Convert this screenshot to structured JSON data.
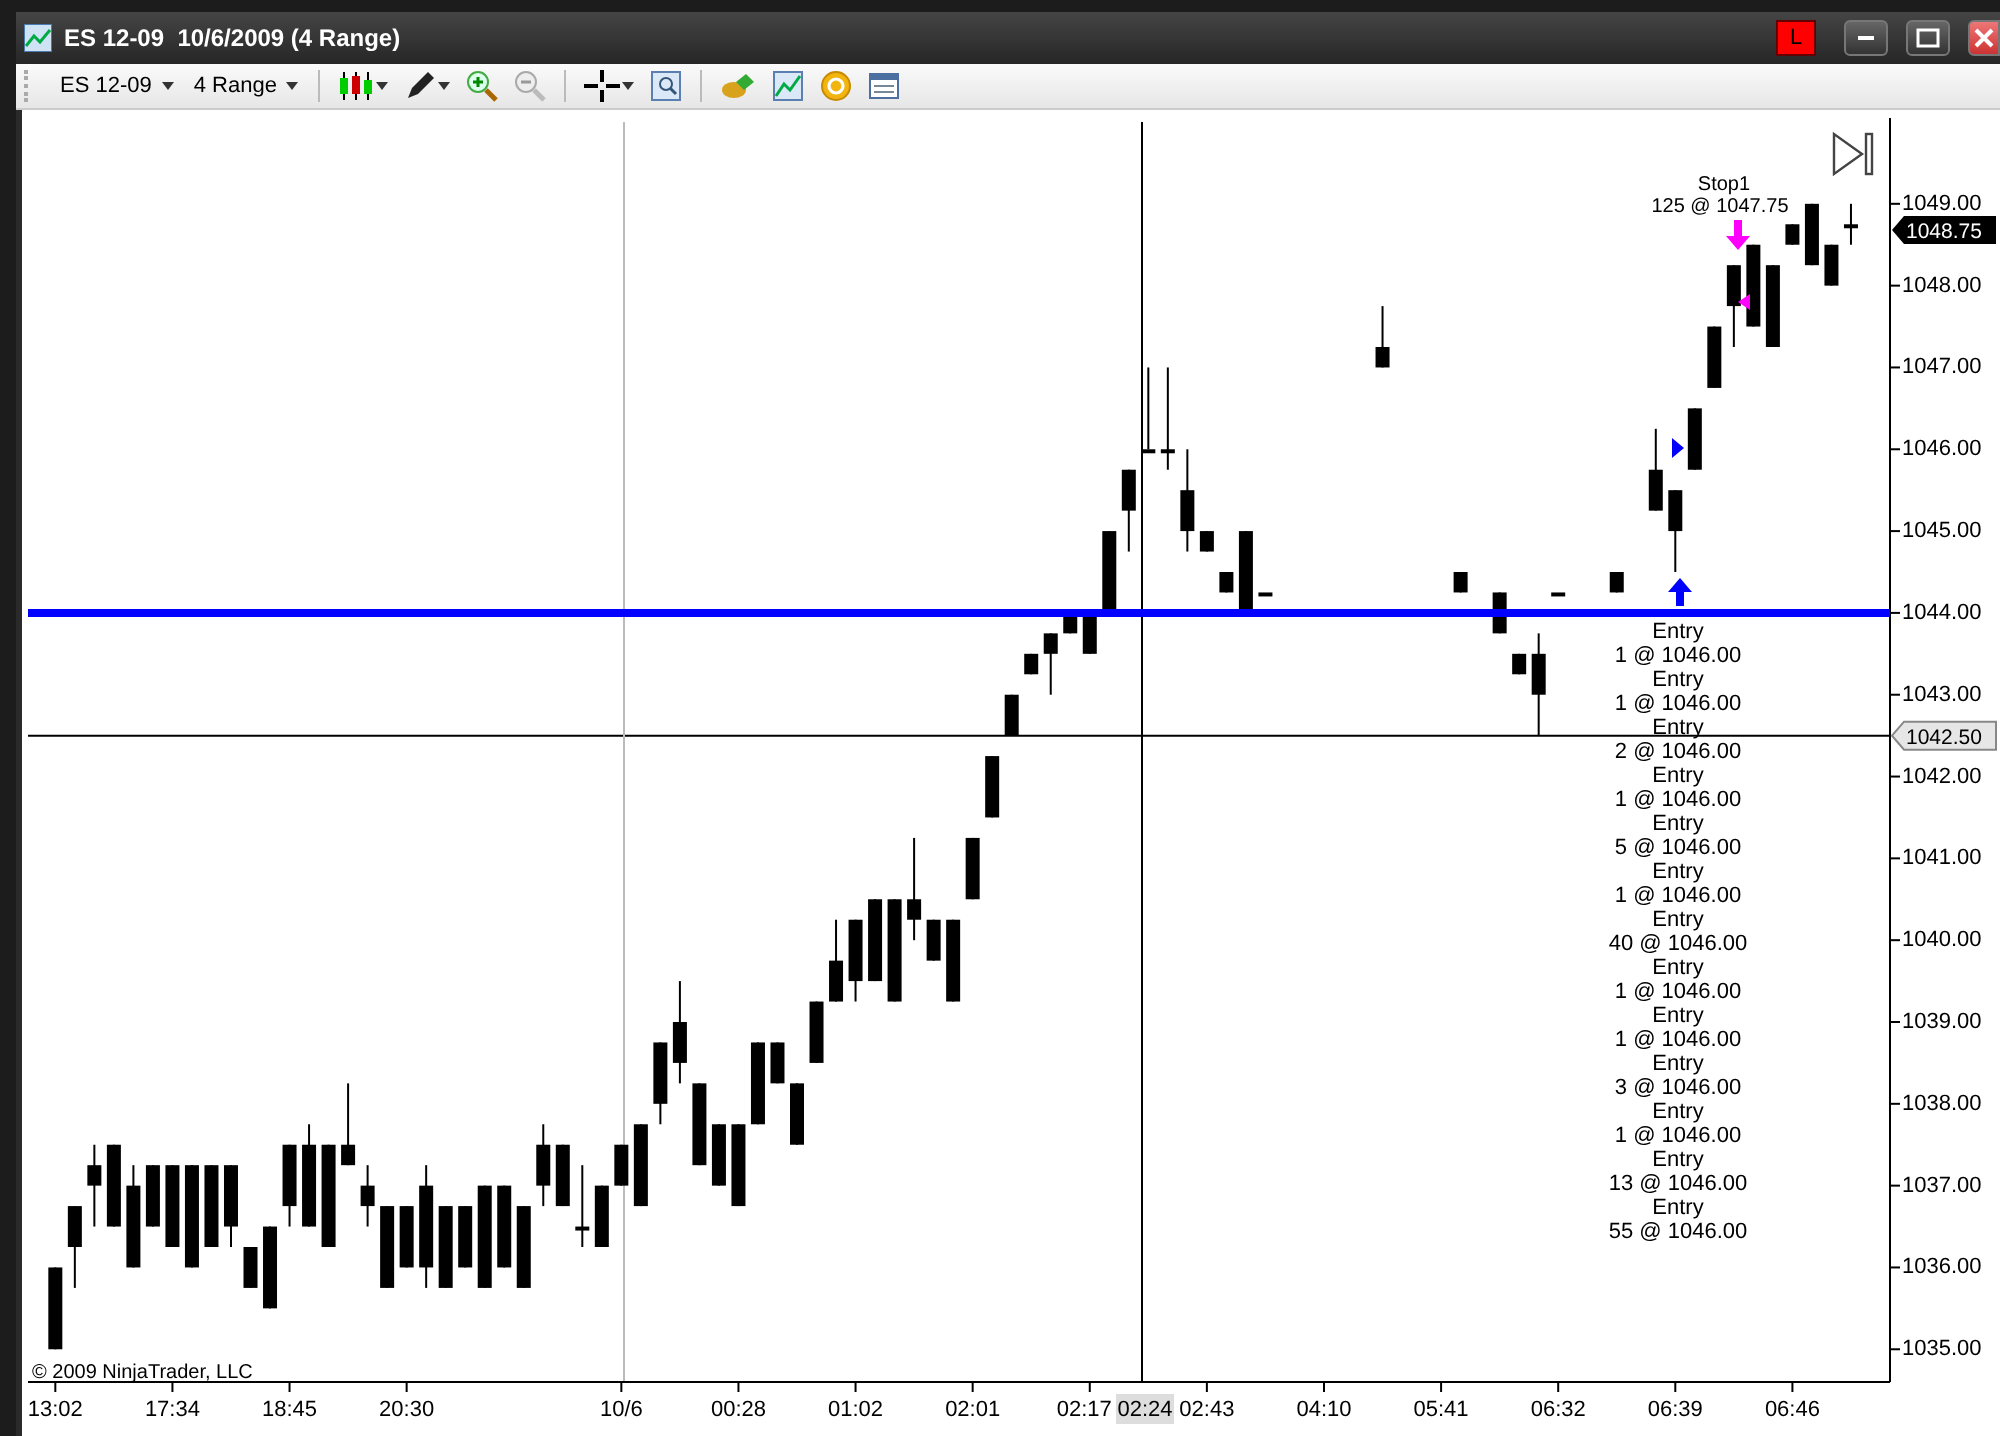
{
  "window": {
    "title": "ES 12-09  10/6/2009 (4 Range)",
    "account_badge": "L"
  },
  "toolbar": {
    "instrument": "ES 12-09",
    "period": "4 Range"
  },
  "chart": {
    "chart_data": {
      "type": "candlestick",
      "ylim": [
        1034.6,
        1050
      ],
      "categories": [
        "13:02",
        null,
        null,
        null,
        null,
        null,
        "17:34",
        null,
        null,
        null,
        null,
        null,
        "18:45",
        null,
        null,
        null,
        null,
        null,
        "20:30",
        null,
        null,
        null,
        null,
        null,
        null,
        null,
        null,
        null,
        null,
        "10/6",
        null,
        null,
        null,
        null,
        null,
        "00:28",
        null,
        null,
        null,
        null,
        null,
        "01:02",
        null,
        null,
        null,
        null,
        null,
        "02:01",
        null,
        null,
        null,
        null,
        null,
        "02:17",
        null,
        null,
        null,
        null,
        null,
        "02:43",
        null,
        null,
        null,
        null,
        null,
        "04:10",
        null,
        null,
        null,
        null,
        null,
        "05:41",
        null,
        null,
        null,
        null,
        null,
        "06:32",
        null,
        null,
        null,
        null,
        null,
        "06:39",
        null,
        null,
        null,
        null,
        null,
        "06:46",
        null,
        null,
        null
      ],
      "ohlc": [
        [
          1036.0,
          1036.0,
          1035.0,
          1035.0
        ],
        [
          1036.75,
          1036.75,
          1035.75,
          1036.25
        ],
        [
          1037.25,
          1037.5,
          1036.5,
          1037.0
        ],
        [
          1037.5,
          1037.5,
          1036.5,
          1036.5
        ],
        [
          1037.0,
          1037.25,
          1036.0,
          1036.0
        ],
        [
          1037.25,
          1037.25,
          1036.5,
          1036.5
        ],
        [
          1037.25,
          1037.25,
          1036.25,
          1036.25
        ],
        [
          1037.25,
          1037.25,
          1036.0,
          1036.0
        ],
        [
          1037.25,
          1037.25,
          1036.25,
          1036.25
        ],
        [
          1037.25,
          1037.25,
          1036.25,
          1036.5
        ],
        [
          1036.25,
          1036.25,
          1035.75,
          1035.75
        ],
        [
          1036.5,
          1036.5,
          1035.5,
          1035.5
        ],
        [
          1037.5,
          1037.5,
          1036.5,
          1036.75
        ],
        [
          1037.5,
          1037.75,
          1036.5,
          1036.5
        ],
        [
          1037.5,
          1037.5,
          1036.25,
          1036.25
        ],
        [
          1037.5,
          1038.25,
          1037.25,
          1037.25
        ],
        [
          1037.0,
          1037.25,
          1036.5,
          1036.75
        ],
        [
          1036.75,
          1036.75,
          1035.75,
          1035.75
        ],
        [
          1036.75,
          1036.75,
          1036.0,
          1036.0
        ],
        [
          1037.0,
          1037.25,
          1035.75,
          1036.0
        ],
        [
          1036.75,
          1036.75,
          1035.75,
          1035.75
        ],
        [
          1036.75,
          1036.75,
          1036.0,
          1036.0
        ],
        [
          1037.0,
          1037.0,
          1035.75,
          1035.75
        ],
        [
          1037.0,
          1037.0,
          1036.0,
          1036.0
        ],
        [
          1036.75,
          1036.75,
          1035.75,
          1035.75
        ],
        [
          1037.5,
          1037.75,
          1036.75,
          1037.0
        ],
        [
          1037.5,
          1037.5,
          1036.75,
          1036.75
        ],
        [
          1036.5,
          1037.25,
          1036.25,
          1036.5
        ],
        [
          1037.0,
          1037.0,
          1036.25,
          1036.25
        ],
        [
          1037.5,
          1037.5,
          1037.0,
          1037.0
        ],
        [
          1037.75,
          1037.75,
          1036.75,
          1036.75
        ],
        [
          1038.75,
          1038.75,
          1037.75,
          1038.0
        ],
        [
          1039.0,
          1039.5,
          1038.25,
          1038.5
        ],
        [
          1038.25,
          1038.25,
          1037.25,
          1037.25
        ],
        [
          1037.75,
          1037.75,
          1037.0,
          1037.0
        ],
        [
          1037.75,
          1037.75,
          1036.75,
          1036.75
        ],
        [
          1038.75,
          1038.75,
          1037.75,
          1037.75
        ],
        [
          1038.75,
          1038.75,
          1038.25,
          1038.25
        ],
        [
          1038.25,
          1038.25,
          1037.5,
          1037.5
        ],
        [
          1039.25,
          1039.25,
          1038.5,
          1038.5
        ],
        [
          1039.75,
          1040.25,
          1039.25,
          1039.25
        ],
        [
          1040.25,
          1040.25,
          1039.25,
          1039.5
        ],
        [
          1040.5,
          1040.5,
          1039.5,
          1039.5
        ],
        [
          1040.5,
          1040.5,
          1039.25,
          1039.25
        ],
        [
          1040.5,
          1041.25,
          1040.0,
          1040.25
        ],
        [
          1040.25,
          1040.25,
          1039.75,
          1039.75
        ],
        [
          1040.25,
          1040.25,
          1039.25,
          1039.25
        ],
        [
          1041.25,
          1041.25,
          1040.5,
          1040.5
        ],
        [
          1042.25,
          1042.25,
          1041.5,
          1041.5
        ],
        [
          1043.0,
          1043.0,
          1042.5,
          1042.5
        ],
        [
          1043.5,
          1043.5,
          1043.25,
          1043.25
        ],
        [
          1043.75,
          1043.75,
          1043.0,
          1043.5
        ],
        [
          1044.0,
          1044.0,
          1043.75,
          1043.75
        ],
        [
          1044.0,
          1044.0,
          1043.5,
          1043.5
        ],
        [
          1045.0,
          1045.0,
          1044.0,
          1044.0
        ],
        [
          1045.75,
          1045.75,
          1044.75,
          1045.25
        ],
        [
          1046.0,
          1047.0,
          1046.0,
          1046.0
        ],
        [
          1046.0,
          1047.0,
          1045.75,
          1046.0
        ],
        [
          1045.5,
          1046.0,
          1044.75,
          1045.0
        ],
        [
          1045.0,
          1045.0,
          1044.75,
          1044.75
        ],
        [
          1044.5,
          1044.5,
          1044.25,
          1044.25
        ],
        [
          1045.0,
          1045.0,
          1044.0,
          1044.0
        ],
        [
          1044.25,
          1044.25,
          1044.25,
          1044.25
        ],
        null,
        null,
        null,
        null,
        null,
        [
          1047.25,
          1047.75,
          1047.0,
          1047.0
        ],
        null,
        null,
        null,
        [
          1044.5,
          1044.5,
          1044.25,
          1044.25
        ],
        null,
        [
          1044.25,
          1044.25,
          1043.75,
          1043.75
        ],
        [
          1043.5,
          1043.5,
          1043.25,
          1043.25
        ],
        [
          1043.5,
          1043.75,
          1042.5,
          1043.0
        ],
        [
          1044.25,
          1044.25,
          1044.25,
          1044.25
        ],
        null,
        null,
        [
          1044.5,
          1044.5,
          1044.25,
          1044.25
        ],
        null,
        [
          1045.75,
          1046.25,
          1045.25,
          1045.25
        ],
        [
          1045.5,
          1045.5,
          1044.5,
          1045.0
        ],
        [
          1046.5,
          1046.5,
          1045.75,
          1045.75
        ],
        [
          1047.5,
          1047.5,
          1046.75,
          1046.75
        ],
        [
          1048.25,
          1048.25,
          1047.25,
          1047.75
        ],
        [
          1048.5,
          1048.5,
          1047.5,
          1047.5
        ],
        [
          1048.25,
          1048.25,
          1047.25,
          1047.25
        ],
        [
          1048.75,
          1048.75,
          1048.5,
          1048.5
        ],
        [
          1049.0,
          1049.0,
          1048.25,
          1048.25
        ],
        [
          1048.5,
          1048.5,
          1048.0,
          1048.0
        ],
        [
          1048.75,
          1049.0,
          1048.5,
          1048.75
        ]
      ],
      "yticks": [
        {
          "value": 1049,
          "label": "1049.00"
        },
        {
          "value": 1048,
          "label": "1048.00"
        },
        {
          "value": 1047,
          "label": "1047.00"
        },
        {
          "value": 1046,
          "label": "1046.00"
        },
        {
          "value": 1045,
          "label": "1045.00"
        },
        {
          "value": 1044,
          "label": "1044.00"
        },
        {
          "value": 1043,
          "label": "1043.00"
        },
        {
          "value": 1042,
          "label": "1042.00"
        },
        {
          "value": 1041,
          "label": "1041.00"
        },
        {
          "value": 1040,
          "label": "1040.00"
        },
        {
          "value": 1039,
          "label": "1039.00"
        },
        {
          "value": 1038,
          "label": "1038.00"
        },
        {
          "value": 1037,
          "label": "1037.00"
        },
        {
          "value": 1036,
          "label": "1036.00"
        },
        {
          "value": 1035,
          "label": "1035.00"
        }
      ]
    },
    "last_price": "1048.75",
    "crosshair_price": "1042.50",
    "crosshair_time": "02:24",
    "stop_order": {
      "label": "Stop1",
      "detail": "125 @ 1047.75"
    },
    "entries": [
      {
        "label": "Entry",
        "detail": "1 @ 1046.00"
      },
      {
        "label": "Entry",
        "detail": "1 @ 1046.00"
      },
      {
        "label": "Entry",
        "detail": "2 @ 1046.00"
      },
      {
        "label": "Entry",
        "detail": "1 @ 1046.00"
      },
      {
        "label": "Entry",
        "detail": "5 @ 1046.00"
      },
      {
        "label": "Entry",
        "detail": "1 @ 1046.00"
      },
      {
        "label": "Entry",
        "detail": "40 @ 1046.00"
      },
      {
        "label": "Entry",
        "detail": "1 @ 1046.00"
      },
      {
        "label": "Entry",
        "detail": "1 @ 1046.00"
      },
      {
        "label": "Entry",
        "detail": "3 @ 1046.00"
      },
      {
        "label": "Entry",
        "detail": "1 @ 1046.00"
      },
      {
        "label": "Entry",
        "detail": "13 @ 1046.00"
      },
      {
        "label": "Entry",
        "detail": "55 @ 1046.00"
      }
    ],
    "copyright": "© 2009 NinjaTrader, LLC"
  }
}
